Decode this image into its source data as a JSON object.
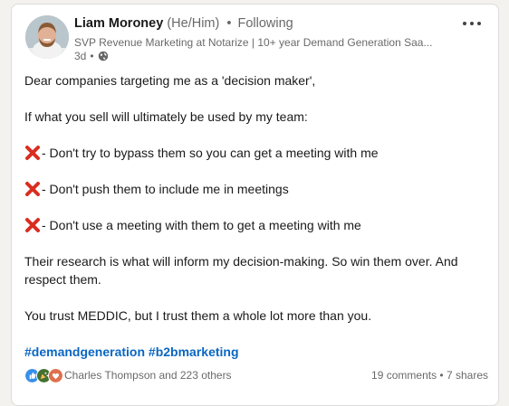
{
  "post": {
    "author": {
      "name": "Liam Moroney",
      "pronouns": "(He/Him)",
      "separator": "•",
      "follow_status": "Following",
      "headline": "SVP Revenue Marketing at Notarize | 10+ year Demand Generation Saa...",
      "time_ago": "3d",
      "meta_separator": "•"
    },
    "body": {
      "intro": "Dear companies targeting me as a 'decision maker',",
      "lead": "If what you sell will ultimately be used by my team:",
      "points": [
        "- Don't try to bypass them so you can get a meeting with me",
        "- Don't push them to include me in meetings",
        "- Don't use a meeting with them to get a meeting with me"
      ],
      "research": "Their research is what will inform my decision-making. So win them over. And respect them.",
      "closing": "You trust MEDDIC, but I trust them a whole lot more than you."
    },
    "hashtags": [
      "#demandgeneration",
      "#b2bmarketing"
    ],
    "social": {
      "reactors_text": "Charles Thompson and 223 others",
      "comments_text": "19 comments",
      "dot": "•",
      "shares_text": "7 shares"
    },
    "reaction_icons": [
      "like-icon",
      "celebrate-icon",
      "love-icon"
    ]
  },
  "colors": {
    "link_blue": "#0a66c2",
    "cross_red": "#d92d20",
    "like_blue": "#378fe9",
    "celebrate_green": "#44712e",
    "love_red": "#df704d"
  }
}
